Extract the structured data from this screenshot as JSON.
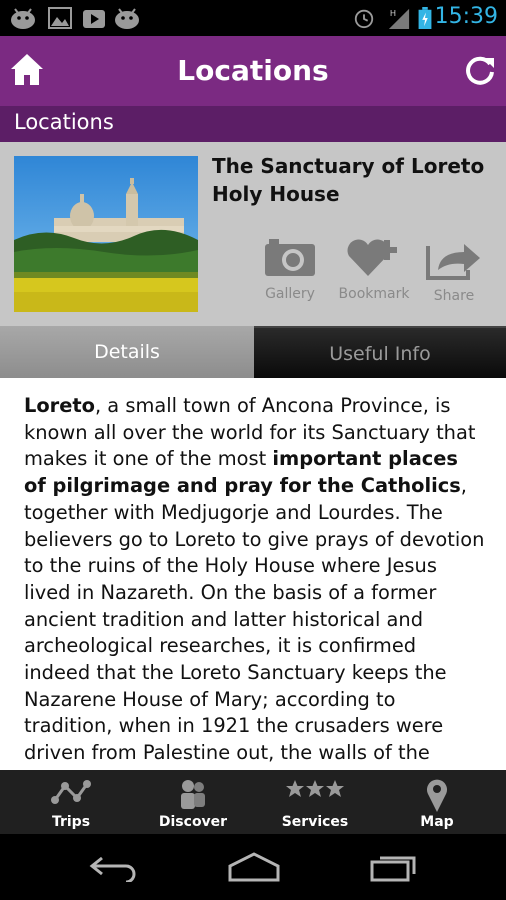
{
  "status_bar": {
    "time": "15:39",
    "left_icons": [
      "android-icon",
      "image-icon",
      "play-store-icon",
      "android-icon"
    ],
    "right_icons": [
      "alarm-icon",
      "signal-icon",
      "battery-icon"
    ]
  },
  "action_bar": {
    "title": "Locations",
    "home_icon": "home-icon",
    "refresh_icon": "refresh-icon"
  },
  "section_header": "Locations",
  "location": {
    "title": "The Sanctuary of Loreto Holy House",
    "actions": [
      {
        "label": "Gallery",
        "icon": "camera-icon"
      },
      {
        "label": "Bookmark",
        "icon": "heart-plus-icon"
      },
      {
        "label": "Share",
        "icon": "share-icon"
      }
    ]
  },
  "tabs": {
    "details": "Details",
    "useful_info": "Useful Info"
  },
  "content": {
    "p1_bold": "Loreto",
    "p1_text": ", a small town of Ancona Province, is known all over the world for its Sanctuary that makes it one of the most ",
    "p1_bold2": "important places of pilgrimage and pray for the Catholics",
    "p1_text2": ", together with Medjugorje and Lourdes. The believers go to Loreto to give prays of devotion to the ruins of the Holy House where Jesus lived in Nazareth. On the basis of a former ancient tradition and latter historical and archeological researches, it is confirmed indeed that the Loreto Sanctuary keeps the Nazarene House of Mary; according to tradition, when in 1921 the crusaders were driven from Palestine out, the walls of the"
  },
  "bottom_nav": [
    {
      "label": "Trips",
      "icon": "route-icon"
    },
    {
      "label": "Discover",
      "icon": "people-icon"
    },
    {
      "label": "Services",
      "icon": "stars-icon"
    },
    {
      "label": "Map",
      "icon": "map-pin-icon"
    }
  ],
  "colors": {
    "action_bar": "#7b2a82",
    "section_bar": "#5c1e66",
    "clock": "#33b5e5"
  }
}
